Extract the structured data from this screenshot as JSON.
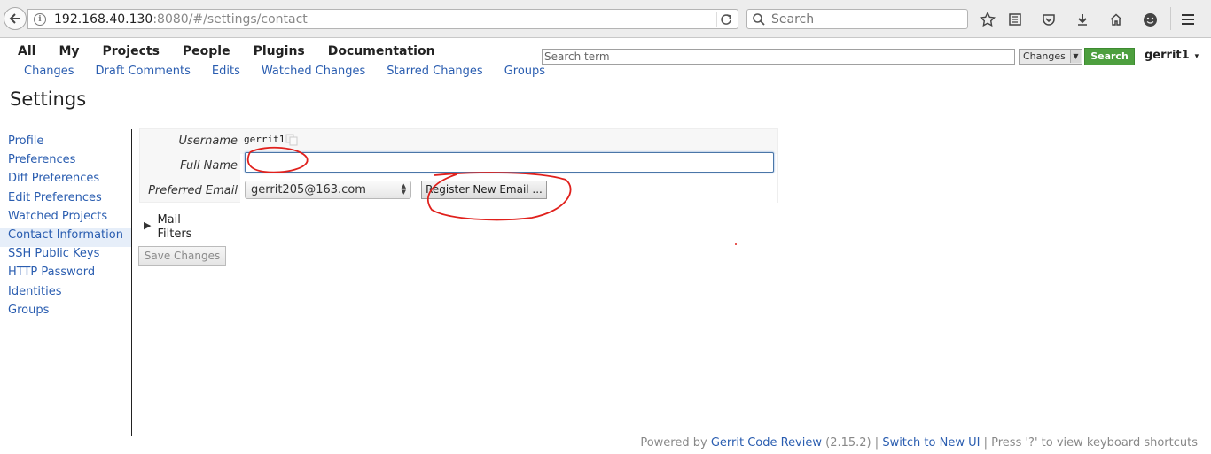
{
  "browser": {
    "url_host": "192.168.40.130",
    "url_rest": ":8080/#/settings/contact",
    "search_placeholder": "Search"
  },
  "topmenu": [
    "All",
    "My",
    "Projects",
    "People",
    "Plugins",
    "Documentation"
  ],
  "submenu": [
    "Changes",
    "Draft Comments",
    "Edits",
    "Watched Changes",
    "Starred Changes",
    "Groups"
  ],
  "header": {
    "search_placeholder": "Search term",
    "scope_value": "Changes",
    "search_button": "Search",
    "user": "gerrit1",
    "user_caret": "▾"
  },
  "page_title": "Settings",
  "sidebar": {
    "items": [
      "Profile",
      "Preferences",
      "Diff Preferences",
      "Edit Preferences",
      "Watched Projects",
      "Contact Information",
      "SSH Public Keys",
      "HTTP Password",
      "Identities",
      "Groups"
    ],
    "active_index": 5
  },
  "contact": {
    "username_label": "Username",
    "username_value": "gerrit1",
    "fullname_label": "Full Name",
    "fullname_value": "",
    "email_label": "Preferred Email",
    "email_value": "gerrit205@163.com",
    "register_button": "Register New Email ...",
    "mail_filters": "Mail Filters",
    "save_button": "Save Changes"
  },
  "footer": {
    "powered_by": "Powered by",
    "product": "Gerrit Code Review",
    "version": "(2.15.2)",
    "sep1": "|",
    "switch_ui": "Switch to New UI",
    "sep2": "|",
    "shortcuts": "Press '?' to view keyboard shortcuts"
  },
  "colors": {
    "link": "#2a5db0",
    "search_button_bg": "#4d9f3e",
    "annotation": "#e0201c"
  }
}
